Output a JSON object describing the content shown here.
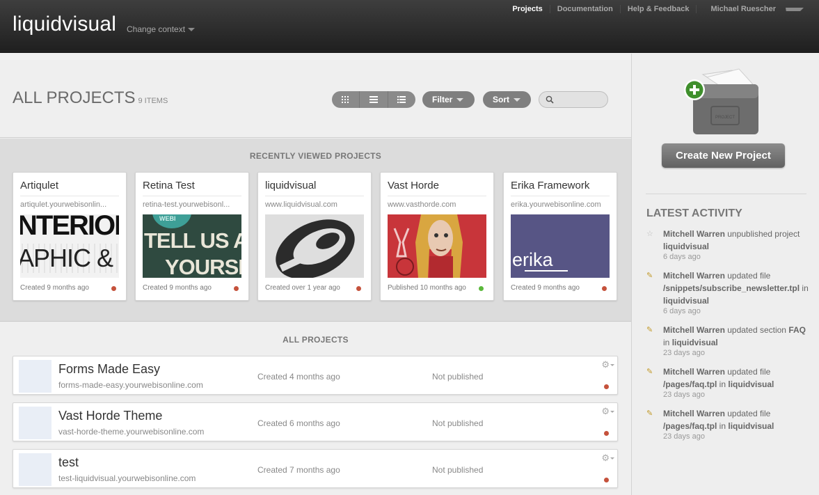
{
  "header": {
    "brand": "liquidvisual",
    "context_label": "Change context",
    "nav": [
      "Projects",
      "Documentation",
      "Help & Feedback",
      "Michael Ruescher"
    ]
  },
  "toolbar": {
    "title": "ALL PROJECTS",
    "count": "9 ITEMS",
    "filter_label": "Filter",
    "sort_label": "Sort",
    "search_placeholder": ""
  },
  "recent": {
    "title": "RECENTLY VIEWED PROJECTS",
    "cards": [
      {
        "name": "Artiqulet",
        "url": "artiqulet.yourwebisonlin...",
        "meta": "Created 9 months ago",
        "status": "unpublished"
      },
      {
        "name": "Retina Test",
        "url": "retina-test.yourwebisonl...",
        "meta": "Created 9 months ago",
        "status": "unpublished"
      },
      {
        "name": "liquidvisual",
        "url": "www.liquidvisual.com",
        "meta": "Created over 1 year ago",
        "status": "unpublished"
      },
      {
        "name": "Vast Horde",
        "url": "www.vasthorde.com",
        "meta": "Published 10 months ago",
        "status": "published"
      },
      {
        "name": "Erika Framework",
        "url": "erika.yourwebisonline.com",
        "meta": "Created 9 months ago",
        "status": "unpublished"
      }
    ],
    "thumb_text": {
      "artiqulet_1": "NTERIORS",
      "artiqulet_2": "APHIC & W",
      "retina_tag": "WEBI",
      "retina_1": "TELL US AB",
      "retina_2": "YOURSEL",
      "erika": "erika"
    }
  },
  "all": {
    "title": "ALL PROJECTS",
    "rows": [
      {
        "name": "Forms Made Easy",
        "url": "forms-made-easy.yourwebisonline.com",
        "created": "Created 4 months ago",
        "published": "Not published"
      },
      {
        "name": "Vast Horde Theme",
        "url": "vast-horde-theme.yourwebisonline.com",
        "created": "Created 6 months ago",
        "published": "Not published"
      },
      {
        "name": "test",
        "url": "test-liquidvisual.yourwebisonline.com",
        "created": "Created 7 months ago",
        "published": "Not published"
      }
    ]
  },
  "sidebar": {
    "folder_label": "PROJECT",
    "create_label": "Create New Project",
    "activity_title": "LATEST ACTIVITY",
    "activity": [
      {
        "user": "Mitchell Warren",
        "action": " unpublished project ",
        "target": "liquidvisual",
        "action2": "",
        "target2": "",
        "when": "6 days ago",
        "icon": "star-icon"
      },
      {
        "user": "Mitchell Warren",
        "action": " updated file ",
        "target": "/snippets/subscribe_newsletter.tpl",
        "action2": " in ",
        "target2": "liquidvisual",
        "when": "6 days ago",
        "icon": "pencil-icon"
      },
      {
        "user": "Mitchell Warren",
        "action": " updated section ",
        "target": "FAQ",
        "action2": " in ",
        "target2": "liquidvisual",
        "when": "23 days ago",
        "icon": "pencil-icon"
      },
      {
        "user": "Mitchell Warren",
        "action": " updated file ",
        "target": "/pages/faq.tpl",
        "action2": " in ",
        "target2": "liquidvisual",
        "when": "23 days ago",
        "icon": "pencil-icon"
      },
      {
        "user": "Mitchell Warren",
        "action": " updated file ",
        "target": "/pages/faq.tpl",
        "action2": " in ",
        "target2": "liquidvisual",
        "when": "23 days ago",
        "icon": "pencil-icon"
      }
    ]
  },
  "colors": {
    "unpublished": "#c5523c",
    "published": "#5ab83b",
    "create_button": "#6e6e6e",
    "plus_badge": "#3f8f2c"
  }
}
